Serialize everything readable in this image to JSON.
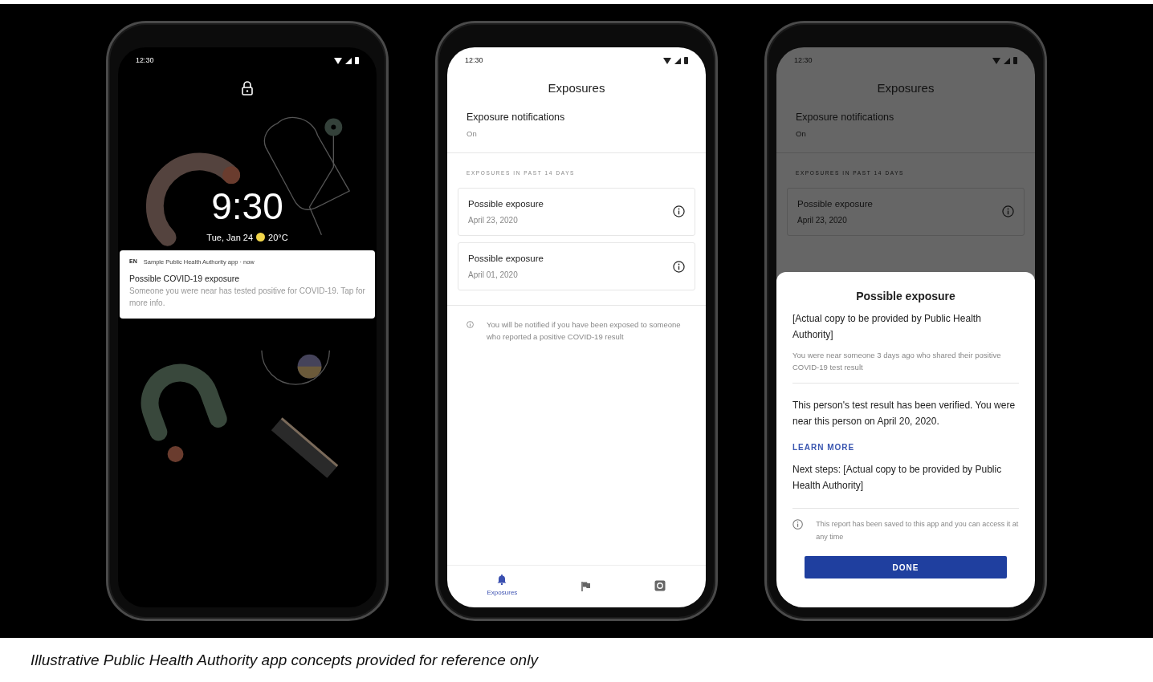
{
  "phones": [
    {
      "kind": "lockscreen",
      "status_time": "12:30",
      "clock": "9:30",
      "date": "Tue, Jan 24",
      "temperature": "20°C",
      "notification": {
        "badge": "EN",
        "app": "Sample Public Health Authority app · now",
        "title": "Possible COVID-19 exposure",
        "body": "Someone you were near has tested positive for COVID-19. Tap for more info."
      }
    },
    {
      "kind": "exposures",
      "dimmed": false,
      "status_time": "12:30",
      "title": "Exposures",
      "setting": {
        "label": "Exposure notifications",
        "value": "On"
      },
      "section": "EXPOSURES IN PAST 14 DAYS",
      "exposures": [
        {
          "title": "Possible exposure",
          "date": "April 23, 2020"
        },
        {
          "title": "Possible exposure",
          "date": "April 01, 2020"
        }
      ],
      "info": "You will be notified if you have been exposed to someone who reported a positive COVID-19 result",
      "tabs": [
        {
          "label": "Exposures",
          "selected": true
        },
        {
          "selected": false
        },
        {
          "selected": false
        }
      ]
    },
    {
      "kind": "exposures",
      "dimmed": true,
      "status_time": "12:30",
      "title": "Exposures",
      "setting": {
        "label": "Exposure notifications",
        "value": "On"
      },
      "section": "EXPOSURES IN PAST 14 DAYS",
      "exposures": [
        {
          "title": "Possible exposure",
          "date": "April 23, 2020"
        }
      ],
      "sheet": {
        "title": "Possible exposure",
        "subtitle": "[Actual copy to be provided by Public Health Authority]",
        "detail": "You were near someone 3 days ago who shared their positive COVID-19 test result",
        "body": "This person's test result has been verified. You were near this person on April 20, 2020.",
        "link": "LEARN MORE",
        "next_steps": "Next steps: [Actual copy to be provided by Public Health Authority]",
        "note": "This report has been saved to this app and you can access it at any time",
        "button": "DONE"
      }
    }
  ],
  "caption": "Illustrative Public Health Authority app concepts provided for reference only"
}
